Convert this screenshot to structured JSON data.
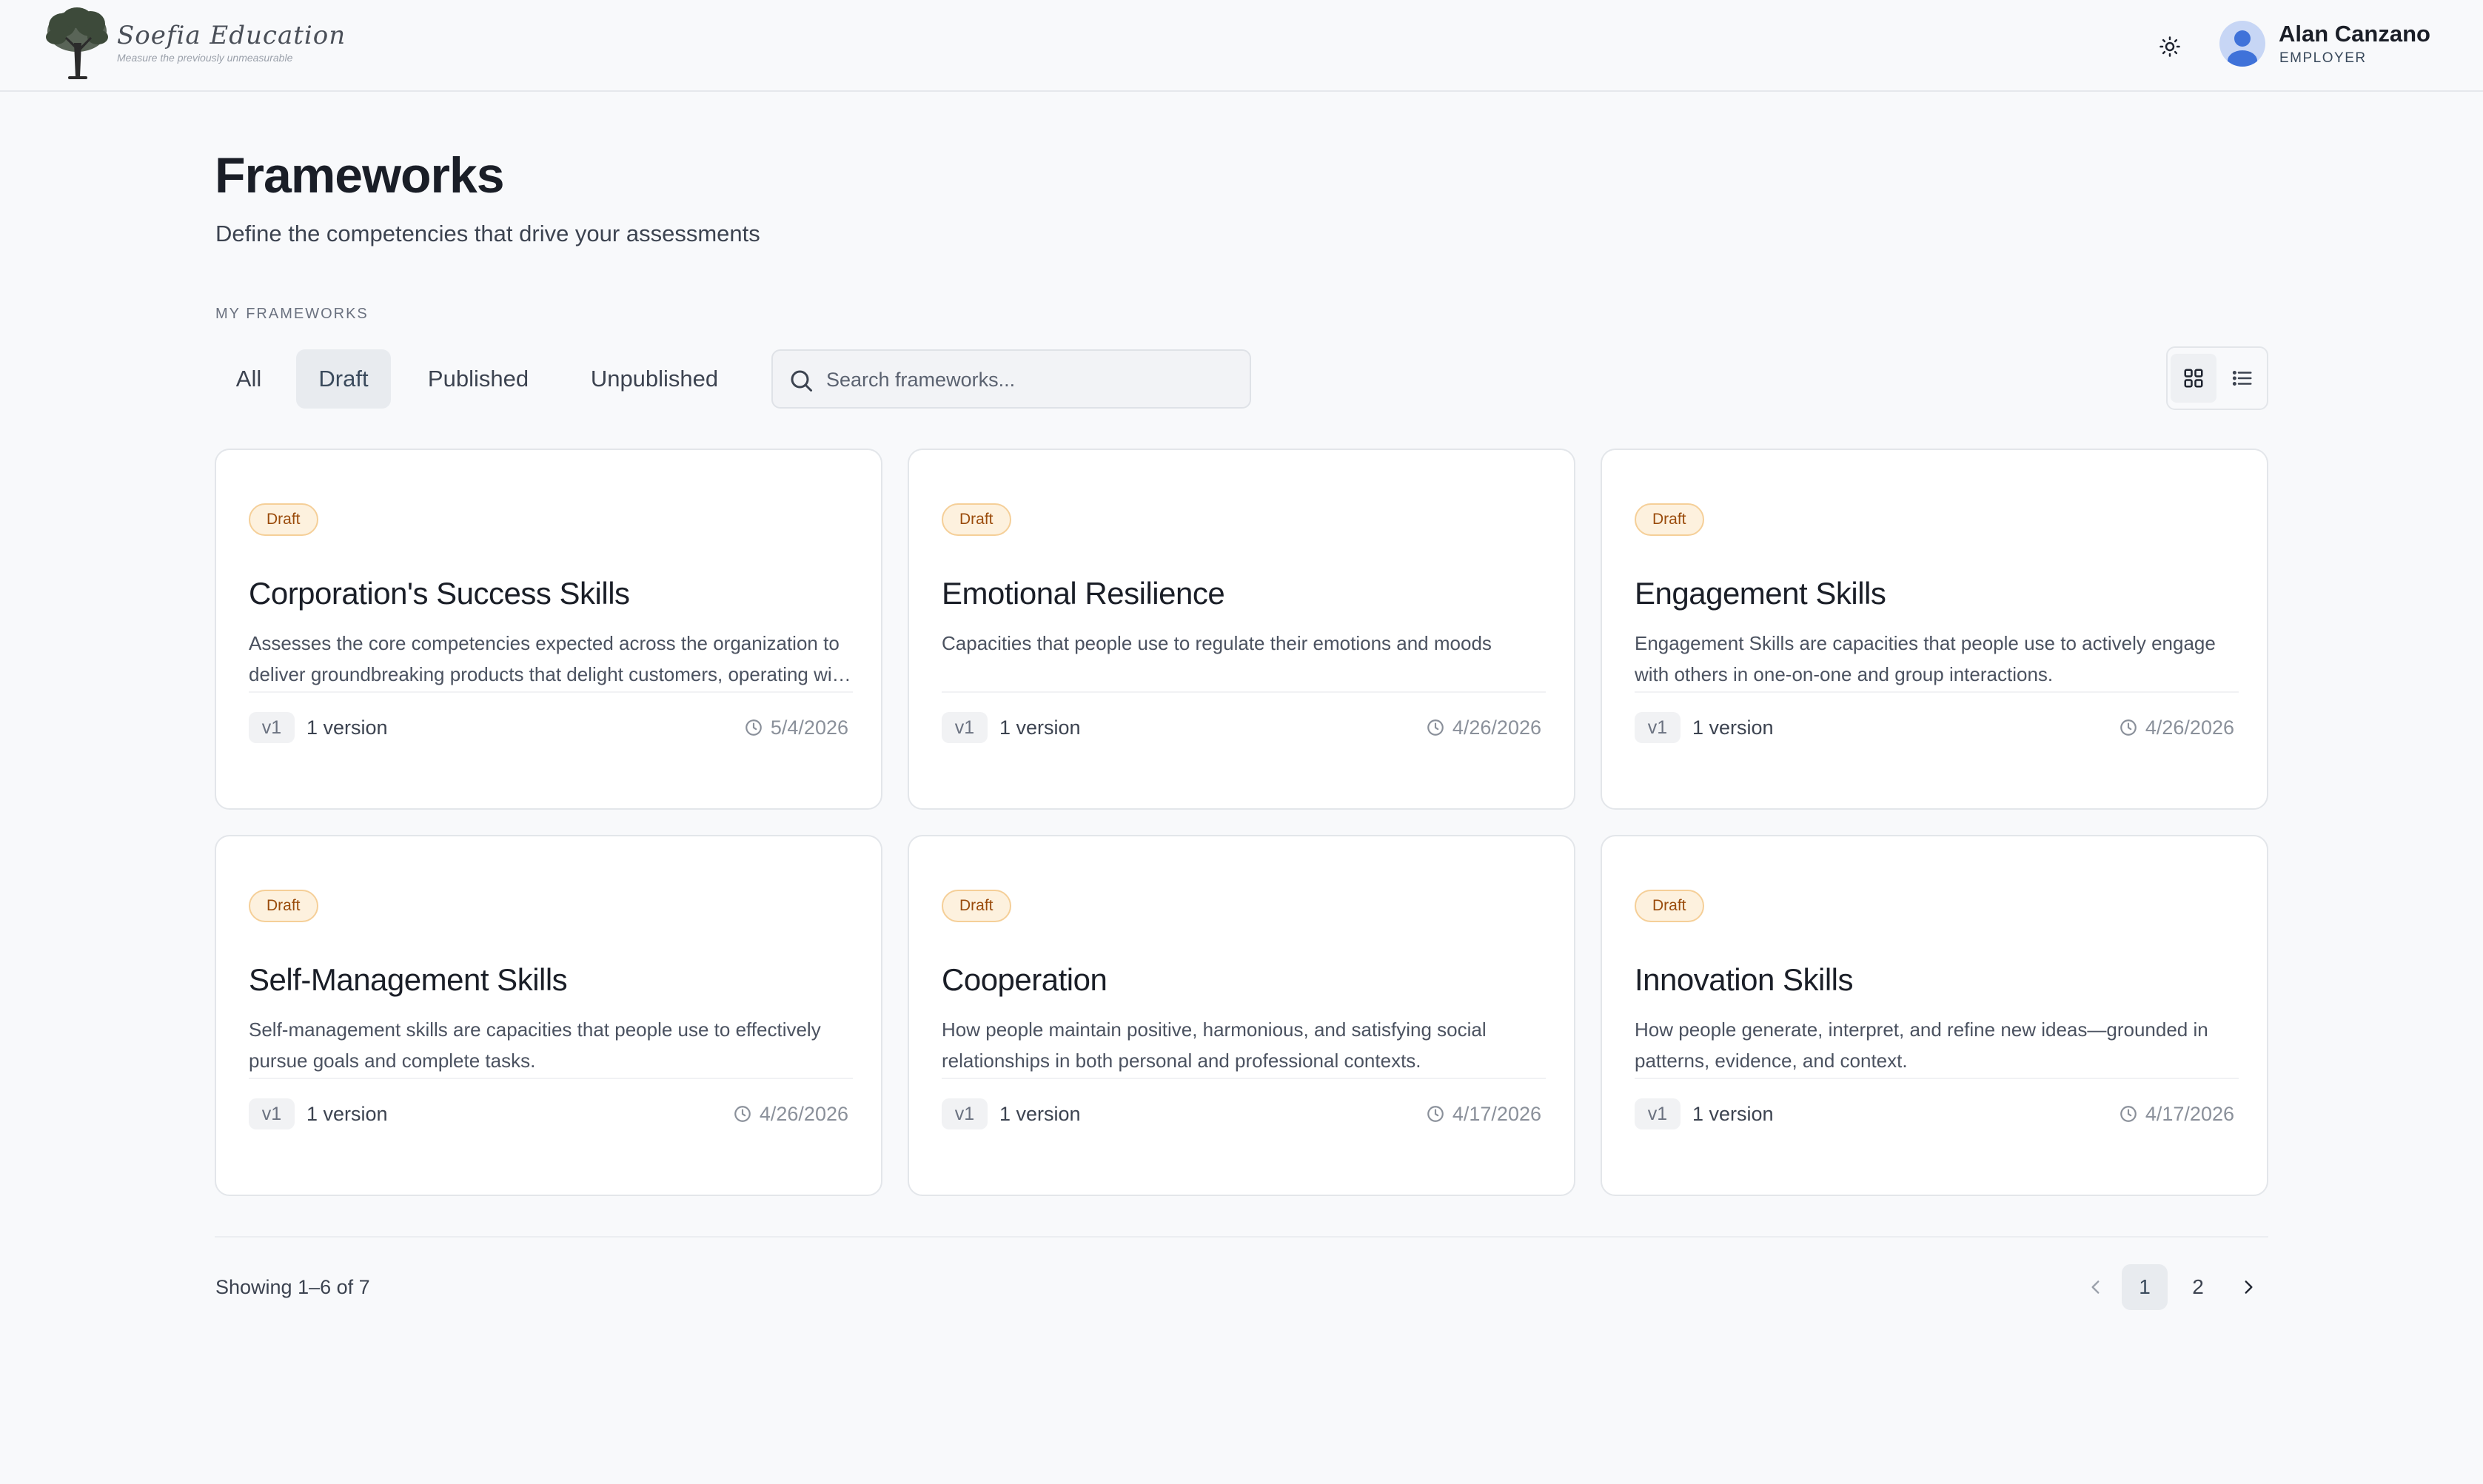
{
  "header": {
    "logo_name": "Soefia Education",
    "logo_tagline": "Measure the previously unmeasurable",
    "user_name": "Alan Canzano",
    "user_role": "EMPLOYER"
  },
  "page": {
    "title": "Frameworks",
    "subtitle": "Define the competencies that drive your assessments",
    "section_label": "MY FRAMEWORKS"
  },
  "filters": {
    "tabs": [
      {
        "label": "All",
        "active": false
      },
      {
        "label": "Draft",
        "active": true
      },
      {
        "label": "Published",
        "active": false
      },
      {
        "label": "Unpublished",
        "active": false
      }
    ],
    "search_placeholder": "Search frameworks..."
  },
  "cards": [
    {
      "status": "Draft",
      "title": "Corporation's Success Skills",
      "description": "Assesses the core competencies expected across the organization to deliver groundbreaking products that delight customers, operating with excellence and integrity.",
      "version": "v1",
      "version_count": "1 version",
      "date": "5/4/2026"
    },
    {
      "status": "Draft",
      "title": "Emotional Resilience",
      "description": "Capacities that people use to regulate their emotions and moods",
      "version": "v1",
      "version_count": "1 version",
      "date": "4/26/2026"
    },
    {
      "status": "Draft",
      "title": "Engagement Skills",
      "description": "Engagement Skills are capacities that people use to actively engage with others in one-on-one and group interactions.",
      "version": "v1",
      "version_count": "1 version",
      "date": "4/26/2026"
    },
    {
      "status": "Draft",
      "title": "Self-Management Skills",
      "description": "Self-management skills are capacities that people use to effectively pursue goals and complete tasks.",
      "version": "v1",
      "version_count": "1 version",
      "date": "4/26/2026"
    },
    {
      "status": "Draft",
      "title": "Cooperation",
      "description": "How people maintain positive, harmonious, and satisfying social relationships in both personal and professional contexts.",
      "version": "v1",
      "version_count": "1 version",
      "date": "4/17/2026"
    },
    {
      "status": "Draft",
      "title": "Innovation Skills",
      "description": "How people generate, interpret, and refine new ideas—grounded in patterns, evidence, and context.",
      "version": "v1",
      "version_count": "1 version",
      "date": "4/17/2026"
    }
  ],
  "pagination": {
    "showing": "Showing 1–6 of 7",
    "pages": [
      "1",
      "2"
    ],
    "current": "1"
  },
  "colors": {
    "badge_bg": "#fdf1de",
    "badge_border": "#f5cf98",
    "badge_text": "#9a4b0b",
    "active_tab_bg": "#e8ebef",
    "page_bg": "#f8f9fb"
  },
  "icons": {
    "theme": "sun-icon",
    "search": "search-icon",
    "grid_view": "grid-icon",
    "list_view": "list-icon",
    "date": "clock-icon",
    "prev": "chevron-left-icon",
    "next": "chevron-right-icon"
  }
}
